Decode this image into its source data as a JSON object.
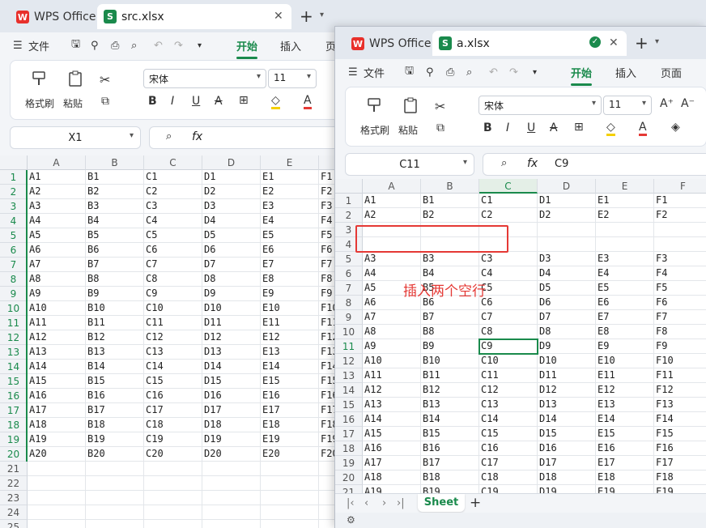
{
  "back_window": {
    "home_tab_label": "WPS Office",
    "doc_tab_label": "src.xlsx",
    "menu": {
      "file": "文件",
      "start": "开始",
      "insert": "插入",
      "more": "页"
    },
    "ribbon": {
      "format_painter": "格式刷",
      "paste": "粘贴",
      "font_name": "宋体",
      "font_size": "11"
    },
    "name_box": "X1",
    "columns": [
      "A",
      "B",
      "C",
      "D",
      "E",
      "F"
    ],
    "rows": [
      "1",
      "2",
      "3",
      "4",
      "5",
      "6",
      "7",
      "8",
      "9",
      "10",
      "11",
      "12",
      "13",
      "14",
      "15",
      "16",
      "17",
      "18",
      "19",
      "20",
      "21",
      "22",
      "23",
      "24",
      "25"
    ],
    "cells": [
      [
        "A1",
        "B1",
        "C1",
        "D1",
        "E1",
        "F1"
      ],
      [
        "A2",
        "B2",
        "C2",
        "D2",
        "E2",
        "F2"
      ],
      [
        "A3",
        "B3",
        "C3",
        "D3",
        "E3",
        "F3"
      ],
      [
        "A4",
        "B4",
        "C4",
        "D4",
        "E4",
        "F4"
      ],
      [
        "A5",
        "B5",
        "C5",
        "D5",
        "E5",
        "F5"
      ],
      [
        "A6",
        "B6",
        "C6",
        "D6",
        "E6",
        "F6"
      ],
      [
        "A7",
        "B7",
        "C7",
        "D7",
        "E7",
        "F7"
      ],
      [
        "A8",
        "B8",
        "C8",
        "D8",
        "E8",
        "F8"
      ],
      [
        "A9",
        "B9",
        "C9",
        "D9",
        "E9",
        "F9"
      ],
      [
        "A10",
        "B10",
        "C10",
        "D10",
        "E10",
        "F10"
      ],
      [
        "A11",
        "B11",
        "C11",
        "D11",
        "E11",
        "F11"
      ],
      [
        "A12",
        "B12",
        "C12",
        "D12",
        "E12",
        "F12"
      ],
      [
        "A13",
        "B13",
        "C13",
        "D13",
        "E13",
        "F13"
      ],
      [
        "A14",
        "B14",
        "C14",
        "D14",
        "E14",
        "F14"
      ],
      [
        "A15",
        "B15",
        "C15",
        "D15",
        "E15",
        "F15"
      ],
      [
        "A16",
        "B16",
        "C16",
        "D16",
        "E16",
        "F16"
      ],
      [
        "A17",
        "B17",
        "C17",
        "D17",
        "E17",
        "F17"
      ],
      [
        "A18",
        "B18",
        "C18",
        "D18",
        "E18",
        "F18"
      ],
      [
        "A19",
        "B19",
        "C19",
        "D19",
        "E19",
        "F19"
      ],
      [
        "A20",
        "B20",
        "C20",
        "D20",
        "E20",
        "F20"
      ]
    ]
  },
  "front_window": {
    "home_tab_label": "WPS Office",
    "doc_tab_label": "a.xlsx",
    "menu": {
      "file": "文件",
      "start": "开始",
      "insert": "插入",
      "page": "页面"
    },
    "ribbon": {
      "format_painter": "格式刷",
      "paste": "粘贴",
      "font_name": "宋体",
      "font_size": "11"
    },
    "name_box": "C11",
    "formula_value": "C9",
    "columns": [
      "A",
      "B",
      "C",
      "D",
      "E",
      "F"
    ],
    "rows": [
      "1",
      "2",
      "3",
      "4",
      "5",
      "6",
      "7",
      "8",
      "9",
      "10",
      "11",
      "12",
      "13",
      "14",
      "15",
      "16",
      "17",
      "18",
      "19",
      "20",
      "21"
    ],
    "cells": [
      [
        "A1",
        "B1",
        "C1",
        "D1",
        "E1",
        "F1"
      ],
      [
        "A2",
        "B2",
        "C2",
        "D2",
        "E2",
        "F2"
      ],
      [
        "",
        "",
        "",
        "",
        "",
        ""
      ],
      [
        "",
        "",
        "",
        "",
        "",
        ""
      ],
      [
        "A3",
        "B3",
        "C3",
        "D3",
        "E3",
        "F3"
      ],
      [
        "A4",
        "B4",
        "C4",
        "D4",
        "E4",
        "F4"
      ],
      [
        "A5",
        "B5",
        "C5",
        "D5",
        "E5",
        "F5"
      ],
      [
        "A6",
        "B6",
        "C6",
        "D6",
        "E6",
        "F6"
      ],
      [
        "A7",
        "B7",
        "C7",
        "D7",
        "E7",
        "F7"
      ],
      [
        "A8",
        "B8",
        "C8",
        "D8",
        "E8",
        "F8"
      ],
      [
        "A9",
        "B9",
        "C9",
        "D9",
        "E9",
        "F9"
      ],
      [
        "A10",
        "B10",
        "C10",
        "D10",
        "E10",
        "F10"
      ],
      [
        "A11",
        "B11",
        "C11",
        "D11",
        "E11",
        "F11"
      ],
      [
        "A12",
        "B12",
        "C12",
        "D12",
        "E12",
        "F12"
      ],
      [
        "A13",
        "B13",
        "C13",
        "D13",
        "E13",
        "F13"
      ],
      [
        "A14",
        "B14",
        "C14",
        "D14",
        "E14",
        "F14"
      ],
      [
        "A15",
        "B15",
        "C15",
        "D15",
        "E15",
        "F15"
      ],
      [
        "A16",
        "B16",
        "C16",
        "D16",
        "E16",
        "F16"
      ],
      [
        "A17",
        "B17",
        "C17",
        "D17",
        "E17",
        "F17"
      ],
      [
        "A18",
        "B18",
        "C18",
        "D18",
        "E18",
        "F18"
      ],
      [
        "A19",
        "B19",
        "C19",
        "D19",
        "E19",
        "F19"
      ]
    ],
    "annotation": "插入两个空行",
    "sheet_tab": "Sheet"
  },
  "colors": {
    "accent": "#1a8a4c",
    "annotation": "#e53935",
    "wps_red": "#e8302b"
  }
}
